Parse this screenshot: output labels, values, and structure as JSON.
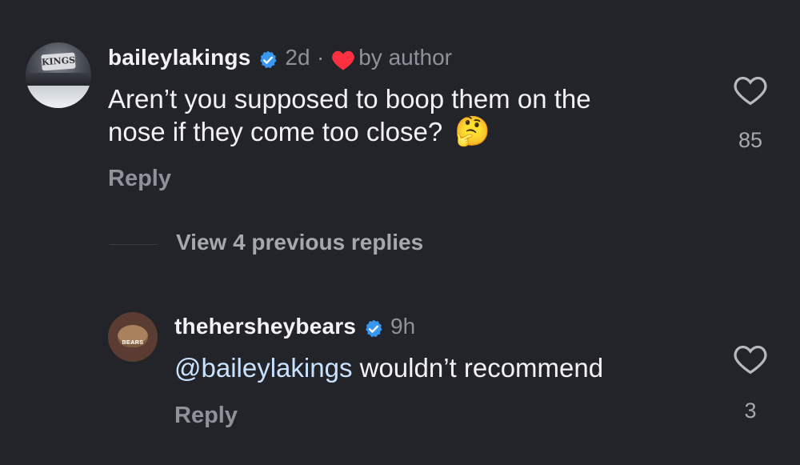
{
  "comment": {
    "username": "baileylakings",
    "time": "2d",
    "separator": "·",
    "liked_by": "by author",
    "text_line1": "Aren’t you supposed to boop them on the",
    "text_line2": "nose if they come too close?",
    "emoji": "🤔",
    "reply_label": "Reply",
    "like_count": "85",
    "avatar_text": "KINGS"
  },
  "view_replies_label": "View 4 previous replies",
  "reply": {
    "username": "thehersheybears",
    "time": "9h",
    "mention": "@baileylakings",
    "text": " wouldn’t recommend",
    "reply_label": "Reply",
    "like_count": "3",
    "avatar_text": "BEARS"
  },
  "colors": {
    "background": "#232429",
    "verified": "#3897f0",
    "heart": "#ff3040",
    "muted": "#8e929a"
  }
}
